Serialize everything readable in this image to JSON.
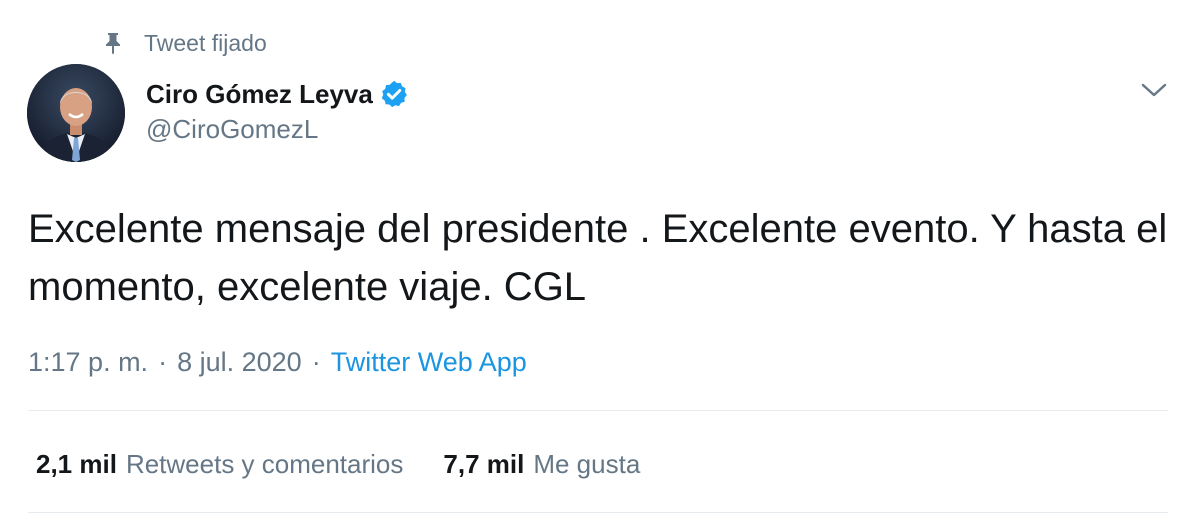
{
  "pinned": {
    "label": "Tweet fijado",
    "icon": "pin-icon"
  },
  "author": {
    "name": "Ciro Gómez Leyva",
    "handle": "@CiroGomezL",
    "verified": true,
    "verified_icon": "verified-badge-icon",
    "avatar_icon": "avatar-photo"
  },
  "menu": {
    "icon": "chevron-down-icon"
  },
  "tweet": {
    "text": "Excelente mensaje del presidente . Excelente evento. Y hasta el momento, excelente viaje. CGL"
  },
  "meta": {
    "time": "1:17 p. m.",
    "separator": "·",
    "date": "8 jul. 2020",
    "source": "Twitter Web App"
  },
  "stats": {
    "retweets_count": "2,1 mil",
    "retweets_label": "Retweets y comentarios",
    "likes_count": "7,7 mil",
    "likes_label": "Me gusta"
  },
  "colors": {
    "link": "#1b95e0",
    "secondary_text": "#657786",
    "primary_text": "#14171a",
    "verified": "#1da1f2",
    "divider": "#e6ecf0"
  }
}
